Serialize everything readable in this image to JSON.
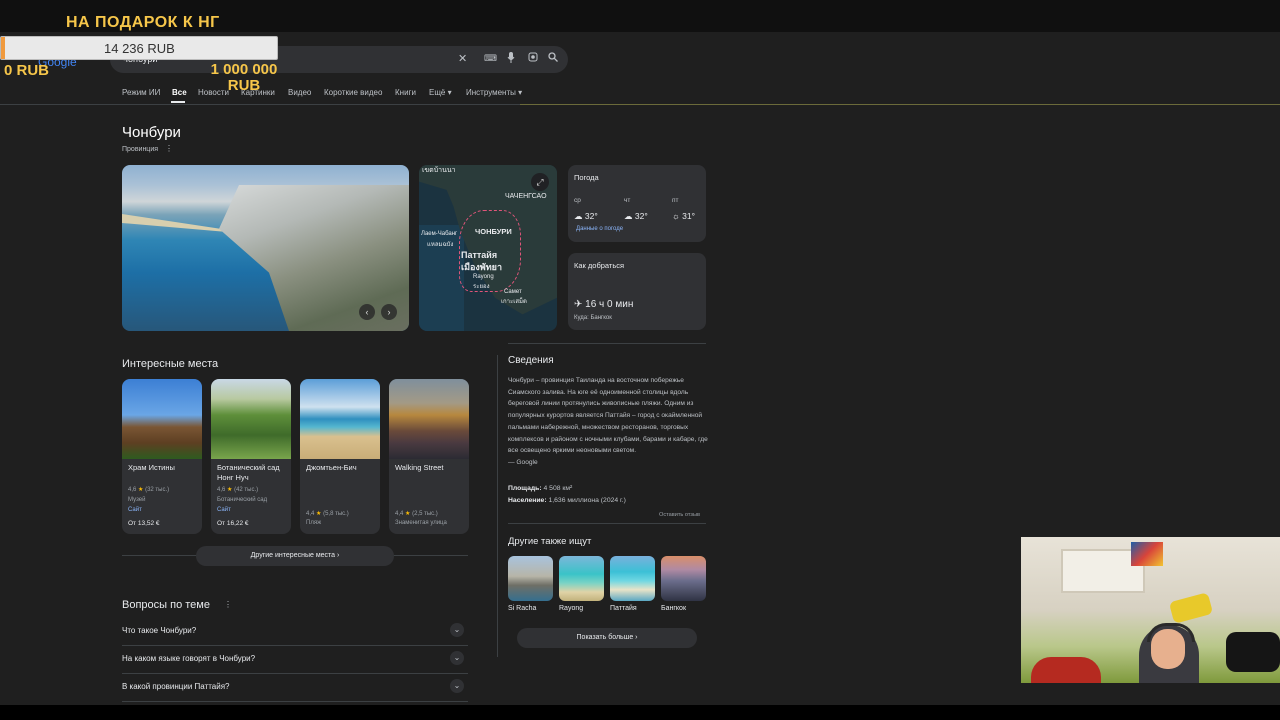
{
  "overlay": {
    "title": "НА ПОДАРОК К НГ",
    "amount": "14 236 RUB",
    "progress_fraction": 0.014,
    "start": "0 RUB",
    "goal": "1 000 000 RUB",
    "accent": "#f6c64a"
  },
  "header": {
    "logo": "Google",
    "query": "Чонбури",
    "icons": [
      "close-icon",
      "keyboard-icon",
      "mic-icon",
      "lens-icon",
      "search-icon"
    ]
  },
  "tabs": [
    "Режим ИИ",
    "Все",
    "Новости",
    "Картинки",
    "Видео",
    "Короткие видео",
    "Книги",
    "Ещё",
    "Инструменты"
  ],
  "tabs_more_arrow": "▾",
  "entity": {
    "title": "Чонбури",
    "subtitle": "Провинция",
    "kebab": "⋮"
  },
  "photo": {
    "prev": "‹",
    "next": "›"
  },
  "map": {
    "labels": {
      "top": "เขตบ้านนา",
      "chachoengsao": "ЧАЧЕНГСАО",
      "chonburi": "ЧОНБУРИ",
      "laem": "Лаем-Чабанг",
      "laem_th": "แหลมฉบัง",
      "pattaya": "Паттайя",
      "pattaya_th": "เมืองพัทยา",
      "rayong": "Rayong",
      "rayong_th": "ระยอง",
      "samet": "Самет",
      "samet_th": "เกาะเสม็ด"
    },
    "expand": "⤢"
  },
  "weather": {
    "title": "Погода",
    "days": [
      {
        "day": "ср",
        "icon": "☁",
        "temp": "32°"
      },
      {
        "day": "чт",
        "icon": "☁",
        "temp": "32°"
      },
      {
        "day": "пт",
        "icon": "☼",
        "temp": "31°"
      }
    ],
    "link": "Данные о погоде"
  },
  "route": {
    "title": "Как добраться",
    "time": "✈ 16 ч 0 мин",
    "dest": "Куда: Бангкок"
  },
  "places": {
    "title": "Интересные места",
    "items": [
      {
        "name": "Храм Истины",
        "rating": "4,6",
        "reviews": "(32 тыс.)",
        "type": "Музей",
        "site": "Сайт",
        "price": "От 13,52 €"
      },
      {
        "name": "Ботанический сад Нонг Нуч",
        "rating": "4,6",
        "reviews": "(42 тыс.)",
        "type": "Ботанический сад",
        "site": "Сайт",
        "price": "От 16,22 €"
      },
      {
        "name": "Джомтьен-Бич",
        "rating": "4,4",
        "reviews": "(5,8 тыс.)",
        "type": "Пляж",
        "site": "",
        "price": ""
      },
      {
        "name": "Walking Street",
        "rating": "4,4",
        "reviews": "(2,5 тыс.)",
        "type": "Знаменитая улица",
        "site": "",
        "price": ""
      }
    ],
    "more": "Другие интересные места ›"
  },
  "faq": {
    "title": "Вопросы по теме",
    "kebab": "⋮",
    "items": [
      "Что такое Чонбури?",
      "На каком языке говорят в Чонбури?",
      "В какой провинции Паттайя?"
    ],
    "chevron": "⌄"
  },
  "about": {
    "title": "Сведения",
    "text": "Чонбури – провинция Таиланда на восточном побережье Сиамского залива. На юге её одноименной столицы вдоль береговой линии протянулись живописные пляжи. Одним из популярных курортов является Паттайя – город с окаймленной пальмами набережной, множеством ресторанов, торговых комплексов и районом с ночными клубами, барами и кабаре, где все освещено яркими неоновыми светом.",
    "source": "— Google",
    "area_label": "Площадь:",
    "area_value": "4 508 км²",
    "population_label": "Население:",
    "population_value": "1,636 миллиона (2024 г.)",
    "feedback": "Оставить отзыв"
  },
  "others": {
    "title": "Другие также ищут",
    "items": [
      "Si Racha",
      "Rayong",
      "Паттайя",
      "Бангкок"
    ],
    "more": "Показать больше ›"
  }
}
